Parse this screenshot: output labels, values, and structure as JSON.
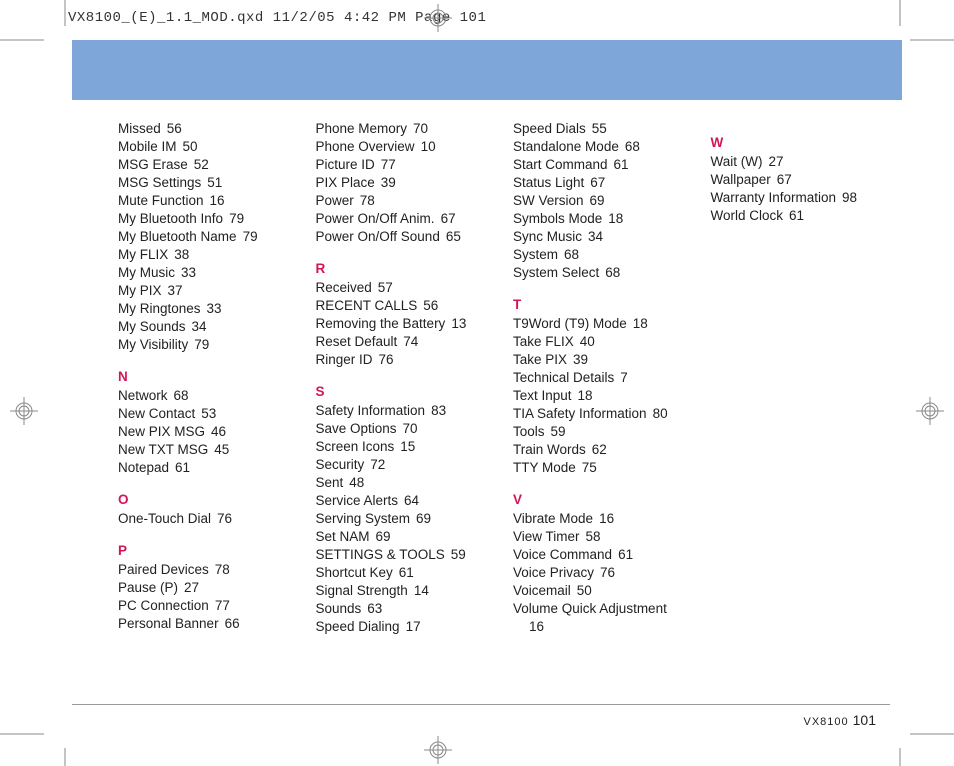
{
  "header_text": "VX8100_(E)_1.1_MOD.qxd  11/2/05  4:42 PM  Page 101",
  "footer_model": "VX8100",
  "footer_page": "101",
  "columns": [
    {
      "groups": [
        {
          "head": null,
          "items": [
            {
              "t": "Missed",
              "p": "56"
            },
            {
              "t": "Mobile IM",
              "p": "50"
            },
            {
              "t": "MSG Erase",
              "p": "52"
            },
            {
              "t": "MSG Settings",
              "p": "51"
            },
            {
              "t": "Mute Function",
              "p": "16"
            },
            {
              "t": "My Bluetooth Info",
              "p": "79"
            },
            {
              "t": "My Bluetooth Name",
              "p": "79"
            },
            {
              "t": "My FLIX",
              "p": "38"
            },
            {
              "t": "My Music",
              "p": "33"
            },
            {
              "t": "My PIX",
              "p": "37"
            },
            {
              "t": "My Ringtones",
              "p": "33"
            },
            {
              "t": "My Sounds",
              "p": "34"
            },
            {
              "t": "My Visibility",
              "p": "79"
            }
          ]
        },
        {
          "head": "N",
          "items": [
            {
              "t": "Network",
              "p": "68"
            },
            {
              "t": "New Contact",
              "p": "53"
            },
            {
              "t": "New PIX MSG",
              "p": "46"
            },
            {
              "t": "New TXT MSG",
              "p": "45"
            },
            {
              "t": "Notepad",
              "p": "61"
            }
          ]
        },
        {
          "head": "O",
          "items": [
            {
              "t": "One-Touch Dial",
              "p": "76"
            }
          ]
        },
        {
          "head": "P",
          "items": [
            {
              "t": "Paired Devices",
              "p": "78"
            },
            {
              "t": "Pause (P)",
              "p": "27"
            },
            {
              "t": "PC Connection",
              "p": "77"
            },
            {
              "t": "Personal Banner",
              "p": "66"
            }
          ]
        }
      ]
    },
    {
      "groups": [
        {
          "head": null,
          "items": [
            {
              "t": "Phone Memory",
              "p": "70"
            },
            {
              "t": "Phone Overview",
              "p": "10"
            },
            {
              "t": "Picture ID",
              "p": "77"
            },
            {
              "t": "PIX Place",
              "p": "39"
            },
            {
              "t": "Power",
              "p": "78"
            },
            {
              "t": "Power On/Off Anim.",
              "p": "67"
            },
            {
              "t": "Power On/Off Sound",
              "p": "65"
            }
          ]
        },
        {
          "head": "R",
          "items": [
            {
              "t": "Received",
              "p": "57"
            },
            {
              "t": "RECENT CALLS",
              "p": "56"
            },
            {
              "t": "Removing the Battery",
              "p": "13"
            },
            {
              "t": "Reset Default",
              "p": "74"
            },
            {
              "t": "Ringer ID",
              "p": "76"
            }
          ]
        },
        {
          "head": "S",
          "items": [
            {
              "t": "Safety Information",
              "p": "83"
            },
            {
              "t": "Save Options",
              "p": "70"
            },
            {
              "t": "Screen Icons",
              "p": "15"
            },
            {
              "t": "Security",
              "p": "72"
            },
            {
              "t": "Sent",
              "p": "48"
            },
            {
              "t": "Service Alerts",
              "p": "64"
            },
            {
              "t": "Serving System",
              "p": "69"
            },
            {
              "t": "Set NAM",
              "p": "69"
            },
            {
              "t": "SETTINGS & TOOLS",
              "p": "59"
            },
            {
              "t": "Shortcut Key",
              "p": "61"
            },
            {
              "t": "Signal Strength",
              "p": "14"
            },
            {
              "t": "Sounds",
              "p": "63"
            },
            {
              "t": "Speed Dialing",
              "p": "17"
            }
          ]
        }
      ]
    },
    {
      "groups": [
        {
          "head": null,
          "items": [
            {
              "t": "Speed Dials",
              "p": "55"
            },
            {
              "t": "Standalone Mode",
              "p": "68"
            },
            {
              "t": "Start Command",
              "p": "61"
            },
            {
              "t": "Status Light",
              "p": "67"
            },
            {
              "t": "SW Version",
              "p": "69"
            },
            {
              "t": "Symbols Mode",
              "p": "18"
            },
            {
              "t": "Sync Music",
              "p": "34"
            },
            {
              "t": "System",
              "p": "68"
            },
            {
              "t": "System Select",
              "p": "68"
            }
          ]
        },
        {
          "head": "T",
          "items": [
            {
              "t": "T9Word (T9) Mode",
              "p": "18"
            },
            {
              "t": "Take FLIX",
              "p": "40"
            },
            {
              "t": "Take PIX",
              "p": "39"
            },
            {
              "t": "Technical Details",
              "p": "7"
            },
            {
              "t": "Text Input",
              "p": "18"
            },
            {
              "t": "TIA Safety Information",
              "p": "80"
            },
            {
              "t": "Tools",
              "p": "59"
            },
            {
              "t": "Train Words",
              "p": "62"
            },
            {
              "t": "TTY Mode",
              "p": "75"
            }
          ]
        },
        {
          "head": "V",
          "items": [
            {
              "t": "Vibrate Mode",
              "p": "16"
            },
            {
              "t": "View Timer",
              "p": "58"
            },
            {
              "t": "Voice Command",
              "p": "61"
            },
            {
              "t": "Voice Privacy",
              "p": "76"
            },
            {
              "t": "Voicemail",
              "p": "50"
            },
            {
              "t": "Volume Quick Adjustment",
              "p": "",
              "wrap": true
            },
            {
              "t": "16",
              "p": "",
              "indent": true
            }
          ]
        }
      ]
    },
    {
      "groups": [
        {
          "head": "W",
          "items": [
            {
              "t": "Wait (W)",
              "p": "27"
            },
            {
              "t": "Wallpaper",
              "p": "67"
            },
            {
              "t": "Warranty Information",
              "p": "98"
            },
            {
              "t": "World Clock",
              "p": "61"
            }
          ]
        }
      ]
    }
  ]
}
